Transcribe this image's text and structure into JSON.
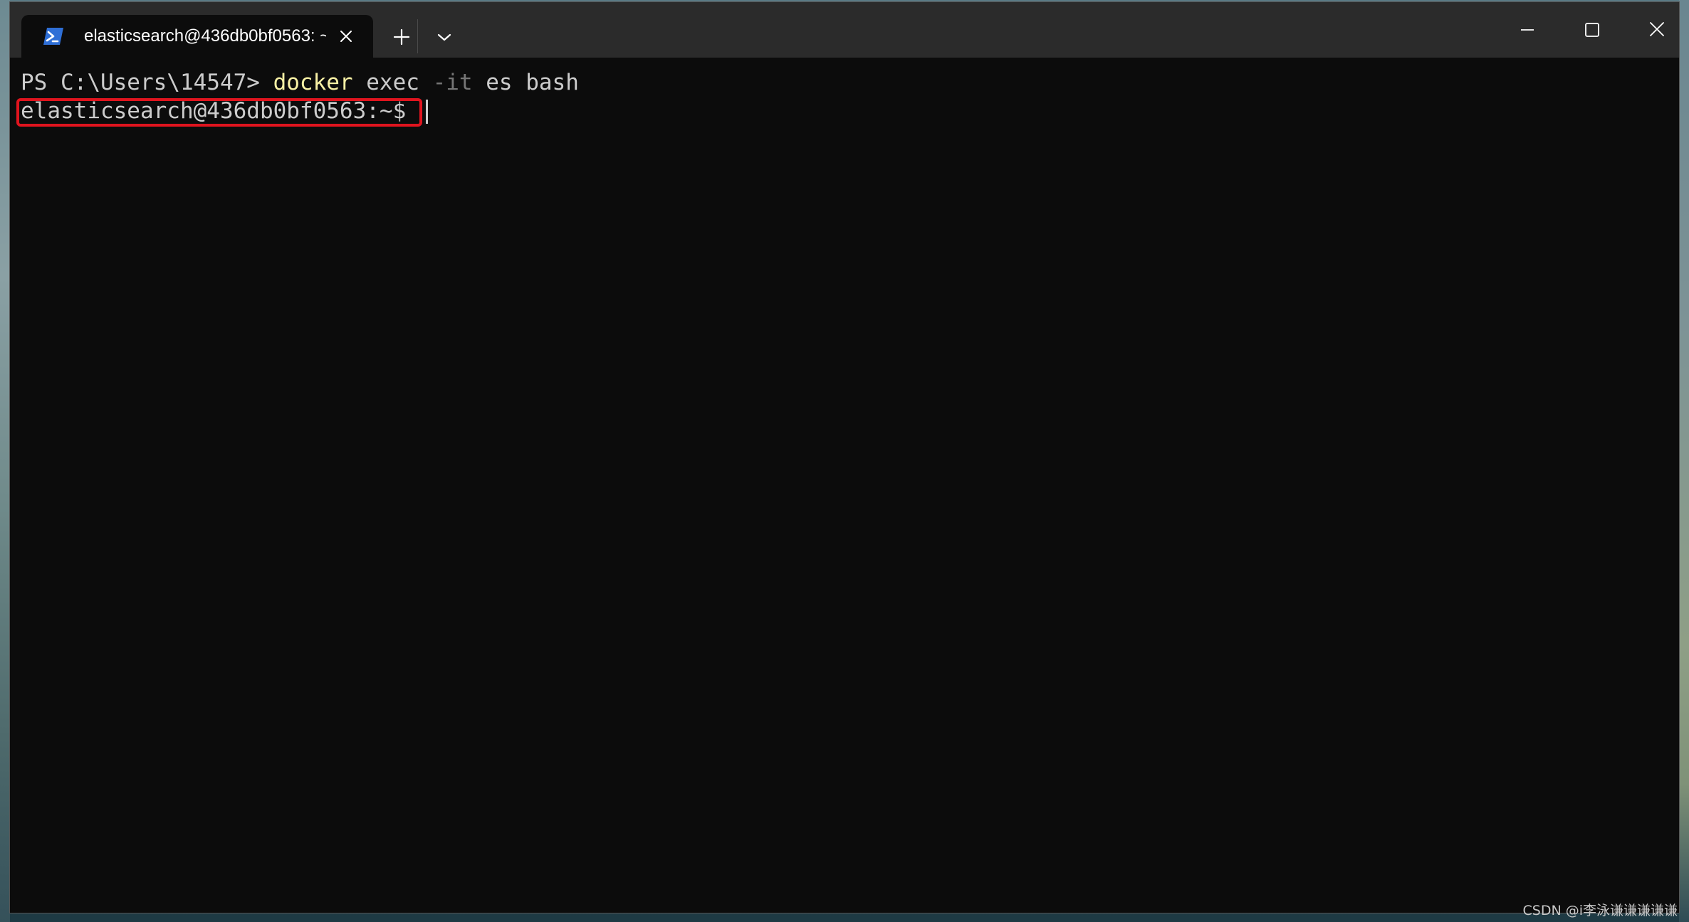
{
  "window": {
    "tab": {
      "title": "elasticsearch@436db0bf0563: ~",
      "icon": "powershell-icon"
    },
    "controls": {
      "new_tab_icon": "plus-icon",
      "dropdown_icon": "chevron-down-icon",
      "minimize_icon": "minimize-icon",
      "maximize_icon": "maximize-icon",
      "close_icon": "close-icon"
    }
  },
  "terminal": {
    "line1": {
      "prompt": "PS C:\\Users\\14547> ",
      "command": "docker",
      "arg1": " exec ",
      "flag": "-it",
      "rest": " es bash"
    },
    "line2": {
      "prompt": "elasticsearch@436db0bf0563:~$"
    },
    "colors": {
      "background": "#0c0c0c",
      "text": "#cccccc",
      "command": "#f9f1a5",
      "parameter": "#767676",
      "highlight_box": "#e0141e"
    }
  },
  "watermark": "CSDN @i李泳谦谦谦谦谦"
}
